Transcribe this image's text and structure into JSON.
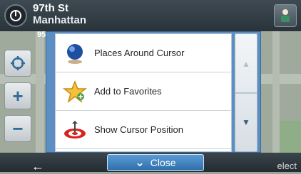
{
  "topbar": {
    "street_line1": "97th St",
    "street_line2": "Manhattan",
    "route_number": "95"
  },
  "map": {
    "side_number": "9"
  },
  "menu": {
    "items": [
      {
        "label": "Places Around Cursor",
        "icon": "globe-pin-icon"
      },
      {
        "label": "Add to Favorites",
        "icon": "star-icon"
      },
      {
        "label": "Show Cursor Position",
        "icon": "target-icon"
      }
    ],
    "scroll_up_icon": "chevron-up-icon",
    "scroll_down_icon": "chevron-down-icon"
  },
  "footer": {
    "close_label": "Close",
    "select_label": "elect"
  },
  "colors": {
    "dialog_bg": "#5b8fc4",
    "accent": "#2f6ea9"
  }
}
